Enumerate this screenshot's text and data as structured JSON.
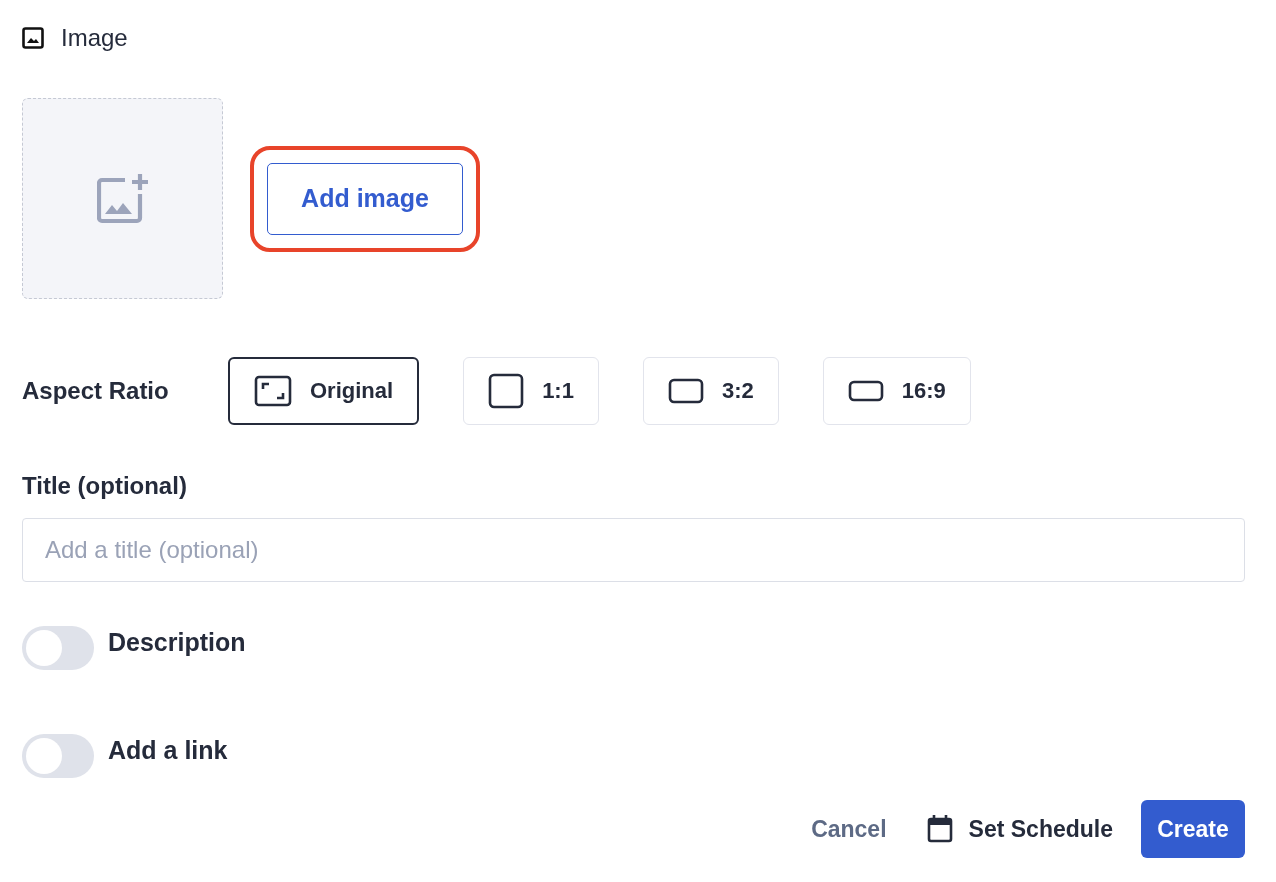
{
  "section": {
    "title": "Image"
  },
  "upload": {
    "button": {
      "label": "Add image",
      "highlighted": true
    }
  },
  "aspect_ratio": {
    "label": "Aspect Ratio",
    "options": [
      {
        "label": "Original",
        "kind": "original",
        "selected": true
      },
      {
        "label": "1:1",
        "kind": "square",
        "selected": false
      },
      {
        "label": "3:2",
        "kind": "landscape",
        "selected": false
      },
      {
        "label": "16:9",
        "kind": "wide",
        "selected": false
      }
    ]
  },
  "title_field": {
    "label": "Title (optional)",
    "placeholder": "Add a title (optional)"
  },
  "toggles": [
    {
      "label": "Description",
      "on": false
    },
    {
      "label": "Add a link",
      "on": false
    }
  ],
  "footer": {
    "cancel": "Cancel",
    "schedule": "Set Schedule",
    "create": "Create"
  }
}
